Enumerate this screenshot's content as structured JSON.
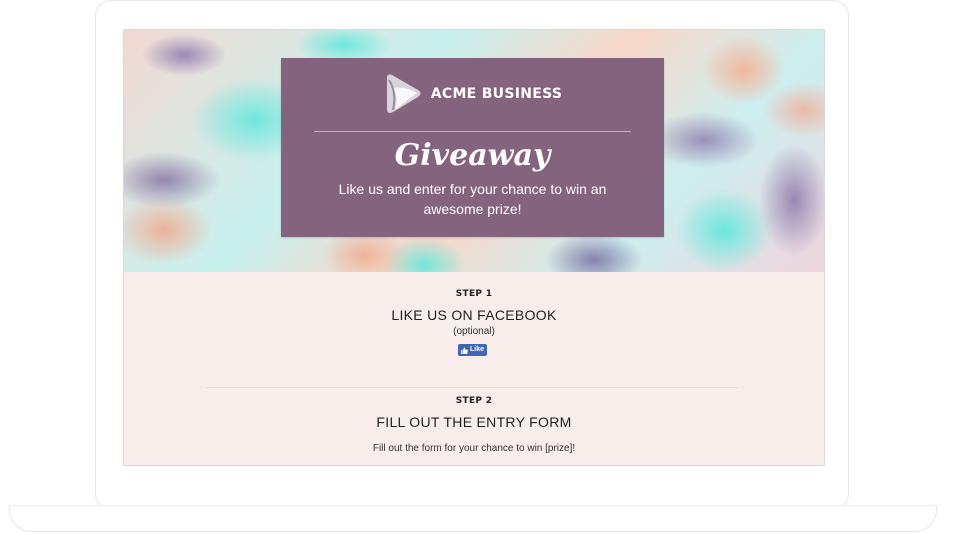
{
  "brand": {
    "name": "ACME BUSINESS",
    "logo_icon": "play-logo-icon"
  },
  "hero": {
    "title": "Giveaway",
    "subtitle": "Like us and enter for your chance to win an awesome prize!",
    "card_color": "#84637f"
  },
  "step1": {
    "label": "STEP 1",
    "heading": "LIKE US ON FACEBOOK",
    "note": "(optional)",
    "like_button": "Like",
    "like_color": "#4267b2"
  },
  "step2": {
    "label": "STEP 2",
    "heading": "FILL OUT THE ENTRY FORM",
    "description": "Fill out the form for your chance to win [prize]!"
  },
  "theme": {
    "page_background": "#f8edea"
  }
}
